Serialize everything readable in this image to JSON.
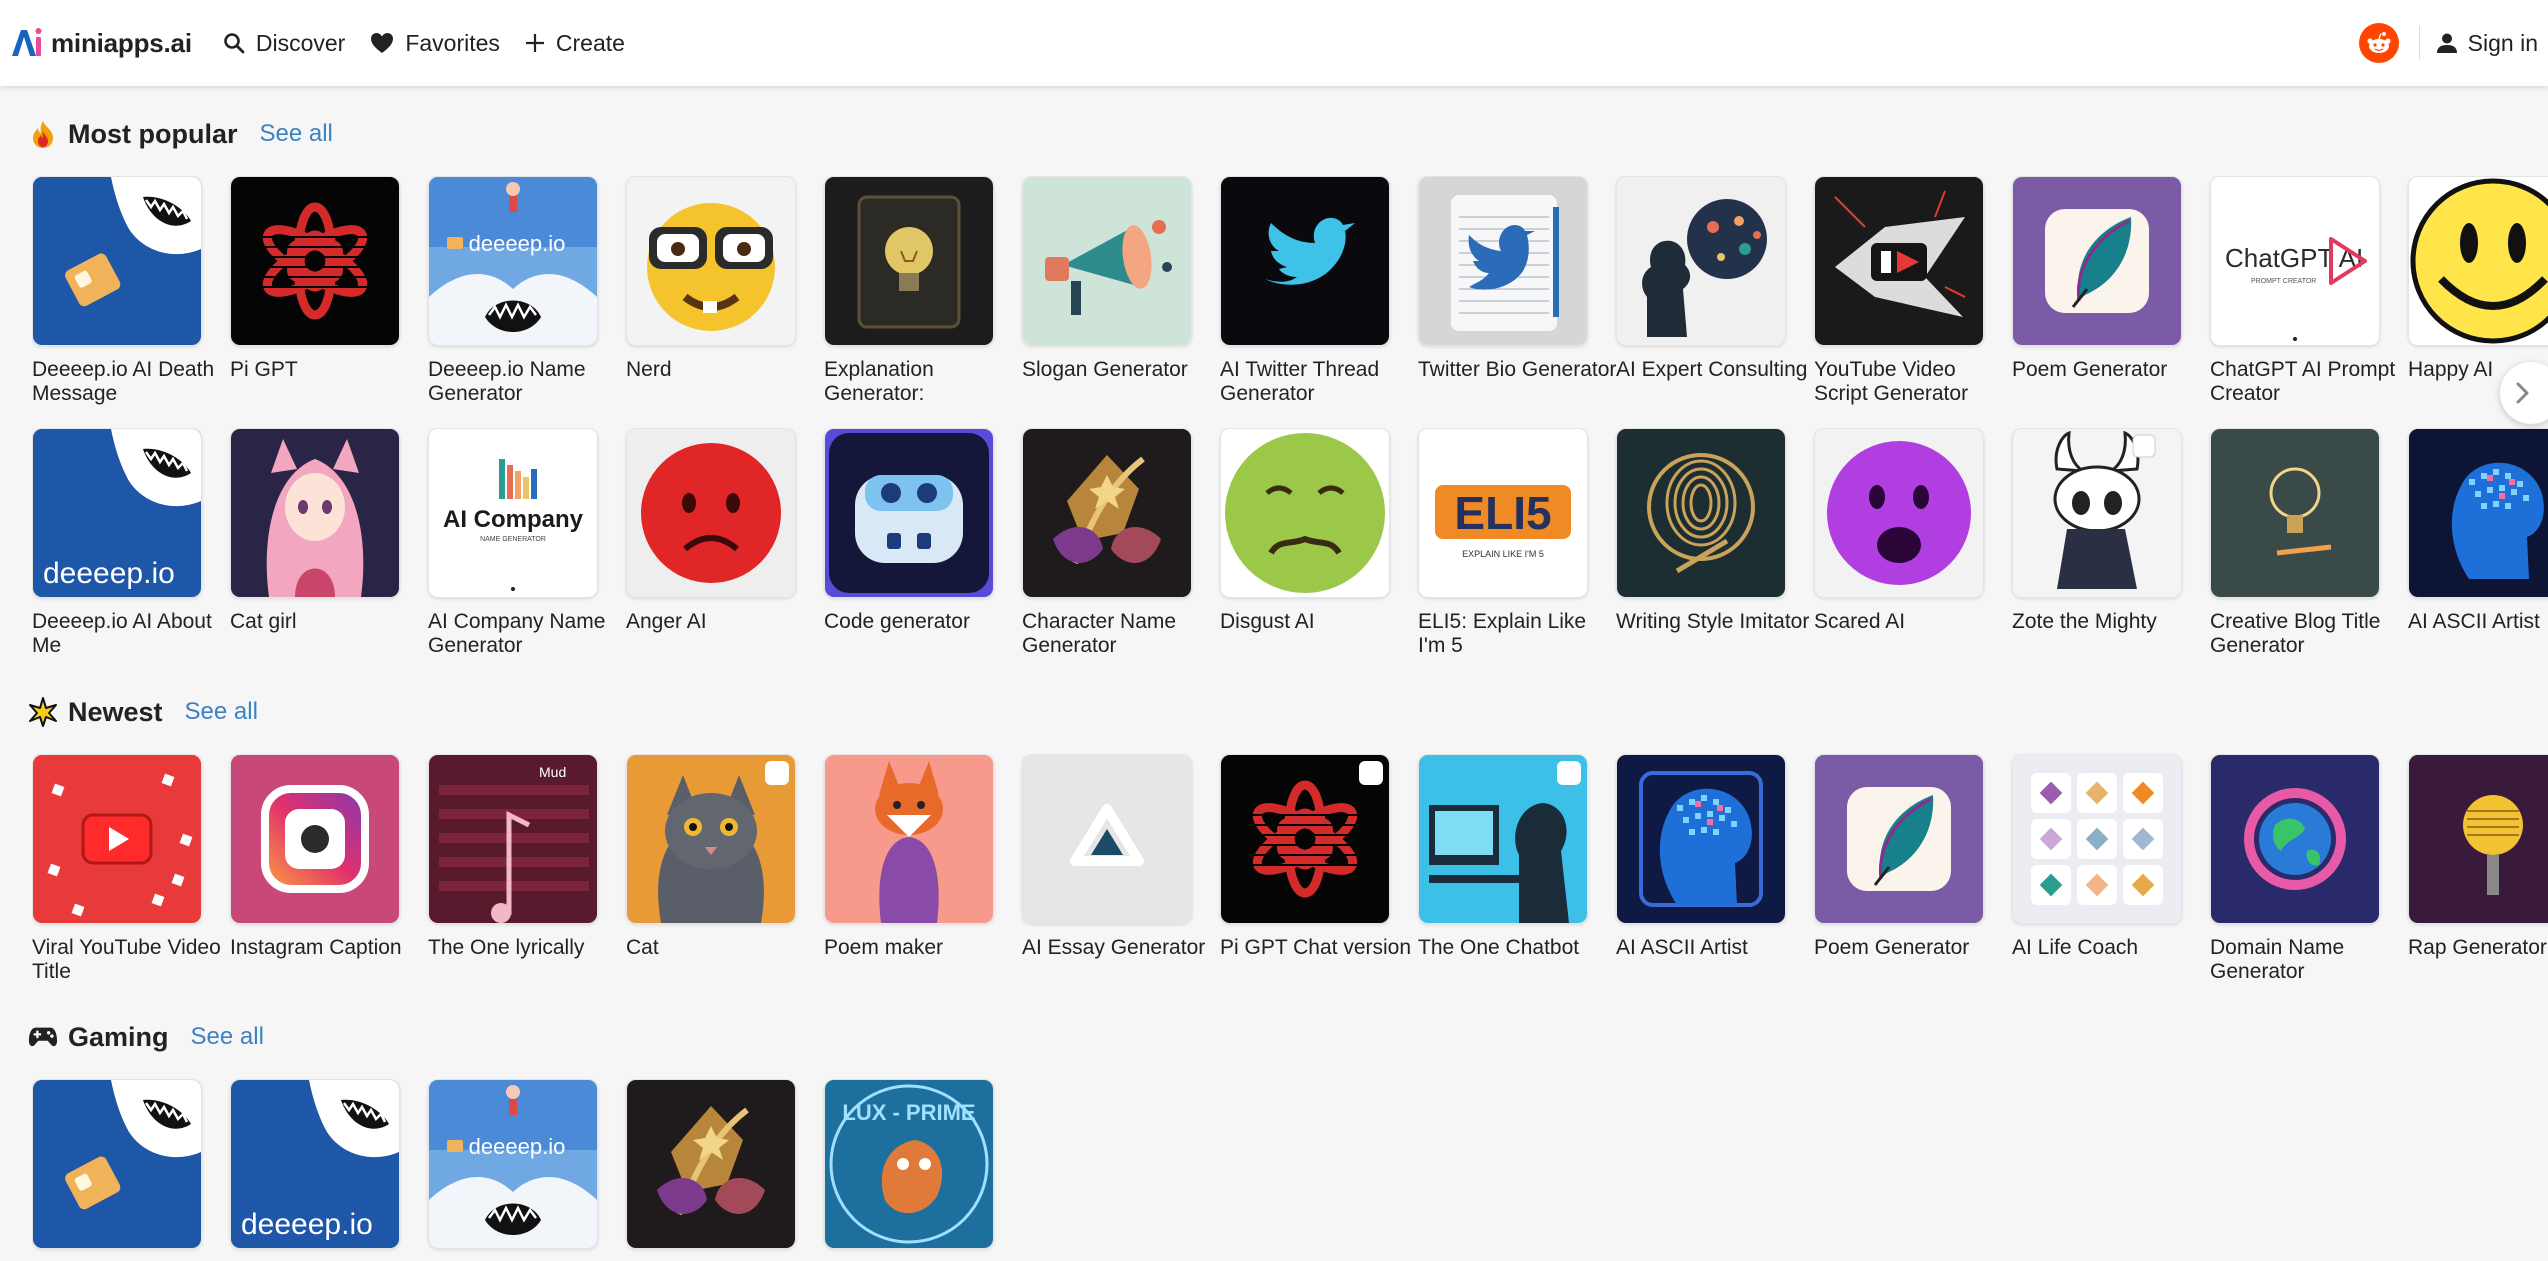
{
  "header": {
    "brand": "miniapps.ai",
    "nav": [
      {
        "label": "Discover",
        "icon": "search-icon"
      },
      {
        "label": "Favorites",
        "icon": "heart-icon"
      },
      {
        "label": "Create",
        "icon": "plus-icon"
      }
    ],
    "signin": "Sign in"
  },
  "colors": {
    "accent_link": "#3b82c4",
    "reddit": "#ff4500",
    "brand_blue": "#1565c0",
    "brand_pink": "#ec4899"
  },
  "sections": {
    "popular": {
      "title": "Most popular",
      "see_all": "See all",
      "icon": "fire-icon",
      "row1": [
        {
          "label": "Deeeep.io AI Death Message",
          "art": "shark-blue"
        },
        {
          "label": "Pi GPT",
          "art": "openai-red"
        },
        {
          "label": "Deeeep.io Name Generator",
          "art": "shark-deeeep"
        },
        {
          "label": "Nerd",
          "art": "nerd-emoji"
        },
        {
          "label": "Explanation Generator:",
          "art": "lightbulb-book"
        },
        {
          "label": "Slogan Generator",
          "art": "megaphone"
        },
        {
          "label": "AI Twitter Thread Generator",
          "art": "twitter-bird"
        },
        {
          "label": "Twitter Bio Generator",
          "art": "bird-notebook"
        },
        {
          "label": "AI Expert Consulting",
          "art": "head-splash"
        },
        {
          "label": "YouTube Video Script Generator",
          "art": "youtube-splash"
        },
        {
          "label": "Poem Generator",
          "art": "feather-purple"
        },
        {
          "label": "ChatGPT AI Prompt Creator",
          "art": "chatgpt-logo"
        },
        {
          "label": "Happy AI",
          "art": "smiley"
        }
      ],
      "row2": [
        {
          "label": "Deeeep.io AI About Me",
          "art": "shark-deeeep-2"
        },
        {
          "label": "Cat girl",
          "art": "anime-girl"
        },
        {
          "label": "AI Company Name Generator",
          "art": "ai-company"
        },
        {
          "label": "Anger AI",
          "art": "angry-emoji"
        },
        {
          "label": "Code generator",
          "art": "robot"
        },
        {
          "label": "Character Name Generator",
          "art": "quill-ornament"
        },
        {
          "label": "Disgust AI",
          "art": "sick-emoji"
        },
        {
          "label": "ELI5: Explain Like I'm 5",
          "art": "eli5"
        },
        {
          "label": "Writing Style Imitator",
          "art": "fingerprint-pen"
        },
        {
          "label": "Scared AI",
          "art": "scared-emoji"
        },
        {
          "label": "Zote the Mighty",
          "art": "hollow-knight"
        },
        {
          "label": "Creative Blog Title Generator",
          "art": "bulb-pencil"
        },
        {
          "label": "AI ASCII Artist",
          "art": "ascii-head"
        }
      ],
      "ai_company_logo": "AI Company",
      "ai_company_sub": "NAME GENERATOR",
      "eli5_logo": "ELI5",
      "eli5_sub": "EXPLAIN LIKE I'M 5",
      "chatgpt_logo": "ChatGPT AI",
      "chatgpt_sub": "PROMPT CREATOR",
      "deeeep_text": "deeeep.io"
    },
    "newest": {
      "title": "Newest",
      "see_all": "See all",
      "icon": "sparkle-icon",
      "items": [
        {
          "label": "Viral YouTube Video Title",
          "art": "youtube-3d"
        },
        {
          "label": "Instagram Caption",
          "art": "instagram"
        },
        {
          "label": "The One lyrically",
          "art": "lyrics"
        },
        {
          "label": "Cat",
          "art": "cat-photo"
        },
        {
          "label": "Poem maker",
          "art": "fox"
        },
        {
          "label": "AI Essay Generator",
          "art": "triangle-logo"
        },
        {
          "label": "Pi GPT Chat version",
          "art": "openai-red-2"
        },
        {
          "label": "The One Chatbot",
          "art": "computer-man"
        },
        {
          "label": "AI ASCII Artist",
          "art": "ascii-head-2"
        },
        {
          "label": "Poem Generator",
          "art": "feather-purple-2"
        },
        {
          "label": "AI Life Coach",
          "art": "icon-grid"
        },
        {
          "label": "Domain Name Generator",
          "art": "globe"
        },
        {
          "label": "Rap Generator",
          "art": "mic"
        }
      ],
      "lyrics_text": "Mud"
    },
    "gaming": {
      "title": "Gaming",
      "see_all": "See all",
      "icon": "gamepad-icon",
      "items": [
        {
          "label": "",
          "art": "shark-blue"
        },
        {
          "label": "",
          "art": "shark-deeeep-2"
        },
        {
          "label": "",
          "art": "shark-deeeep"
        },
        {
          "label": "",
          "art": "quill-ornament"
        },
        {
          "label": "",
          "art": "lux-prime"
        }
      ],
      "lux_text": "LUX - PRIME"
    }
  }
}
